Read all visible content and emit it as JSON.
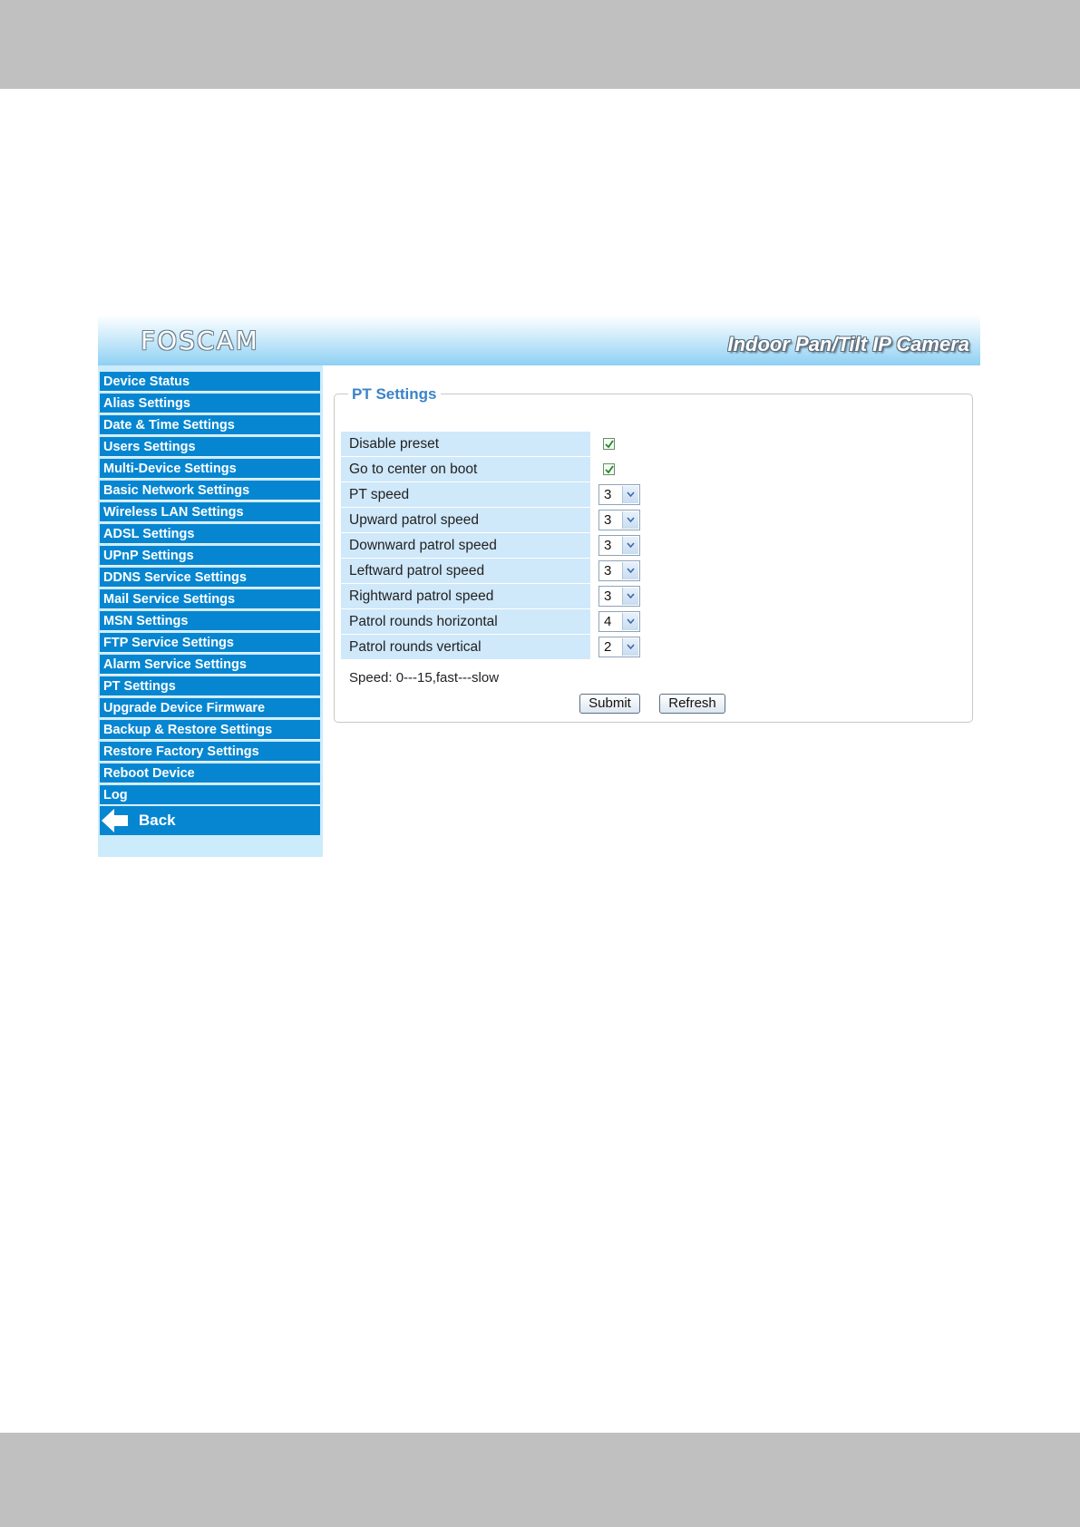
{
  "header": {
    "logo": "FOSCAM",
    "product": "Indoor Pan/Tilt IP Camera"
  },
  "sidebar": {
    "items": [
      {
        "label": "Device Status"
      },
      {
        "label": "Alias Settings"
      },
      {
        "label": "Date & Time Settings"
      },
      {
        "label": "Users Settings"
      },
      {
        "label": "Multi-Device Settings"
      },
      {
        "label": "Basic Network Settings"
      },
      {
        "label": "Wireless LAN Settings"
      },
      {
        "label": "ADSL Settings"
      },
      {
        "label": "UPnP Settings"
      },
      {
        "label": "DDNS Service Settings"
      },
      {
        "label": "Mail Service Settings"
      },
      {
        "label": "MSN Settings"
      },
      {
        "label": "FTP Service Settings"
      },
      {
        "label": "Alarm Service Settings"
      },
      {
        "label": "PT Settings"
      },
      {
        "label": "Upgrade Device Firmware"
      },
      {
        "label": "Backup & Restore Settings"
      },
      {
        "label": "Restore Factory Settings"
      },
      {
        "label": "Reboot Device"
      },
      {
        "label": "Log"
      }
    ],
    "back_label": "Back"
  },
  "panel": {
    "title": "PT Settings",
    "checkbox_rows": [
      {
        "label": "Disable preset",
        "checked": true
      },
      {
        "label": "Go to center on boot",
        "checked": true
      }
    ],
    "select_rows": [
      {
        "label": "PT speed",
        "value": "3"
      },
      {
        "label": "Upward patrol speed",
        "value": "3"
      },
      {
        "label": "Downward patrol speed",
        "value": "3"
      },
      {
        "label": "Leftward patrol speed",
        "value": "3"
      },
      {
        "label": "Rightward patrol speed",
        "value": "3"
      },
      {
        "label": "Patrol rounds horizontal",
        "value": "4"
      },
      {
        "label": "Patrol rounds vertical",
        "value": "2"
      }
    ],
    "note": "Speed: 0---15,fast---slow",
    "submit_label": "Submit",
    "refresh_label": "Refresh"
  },
  "colors": {
    "menu_bg": "#0686d1",
    "label_bg": "#cfe8fa",
    "sidebar_bg": "#ccebfb",
    "title": "#3b83c9",
    "page_band": "#c0c0c0"
  }
}
